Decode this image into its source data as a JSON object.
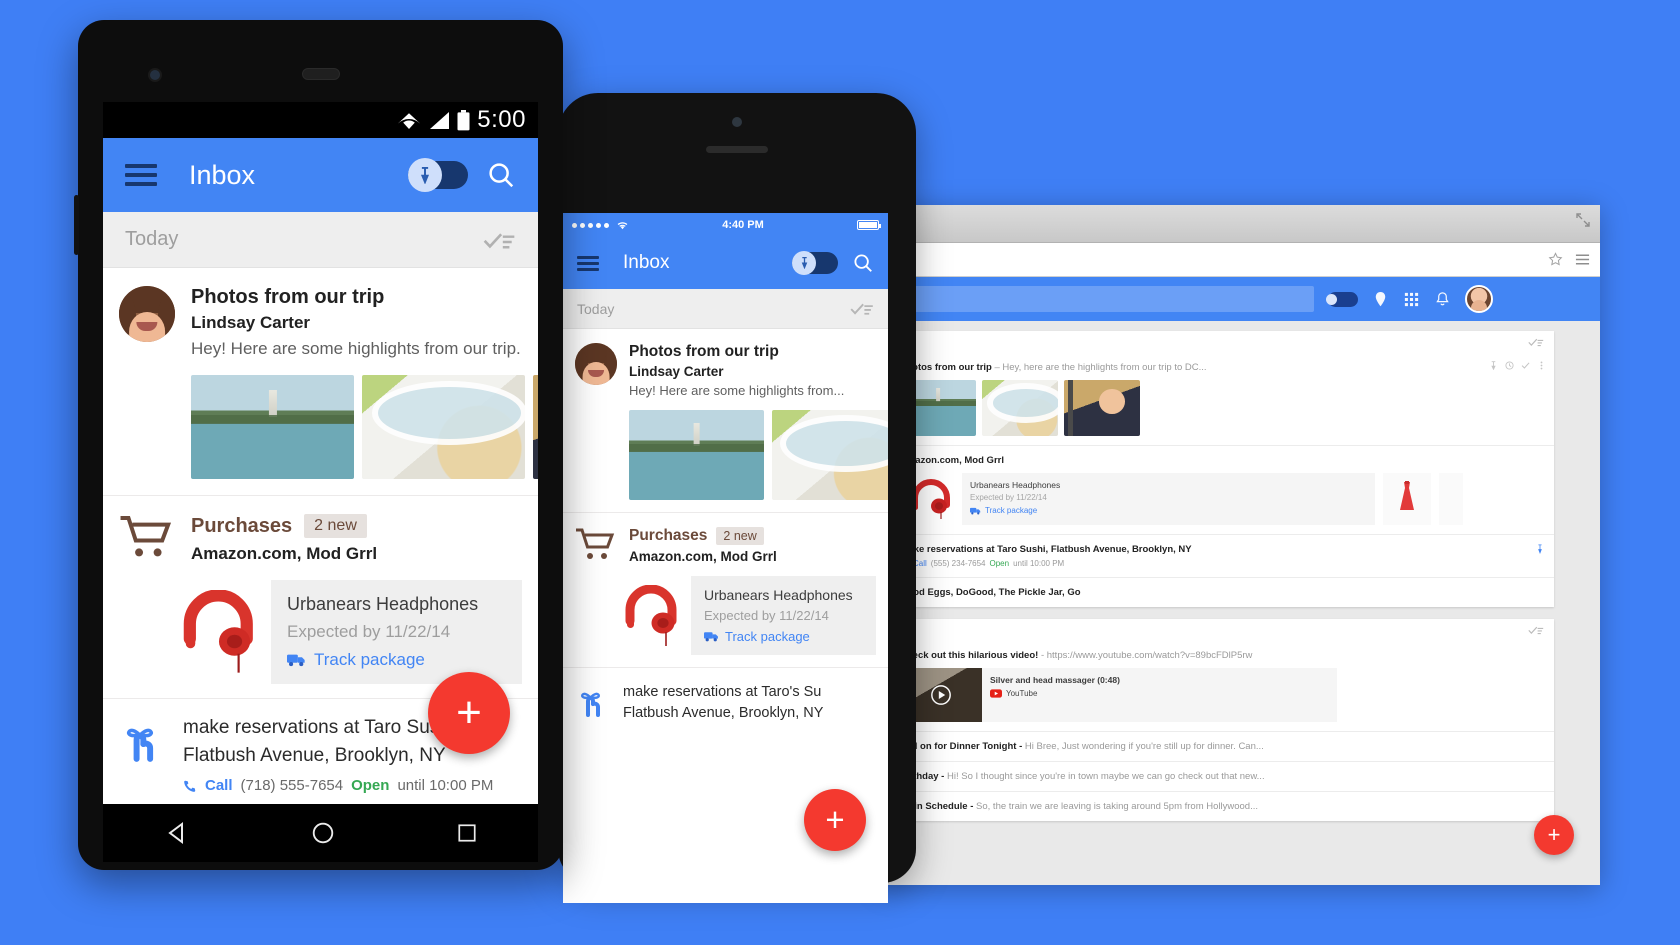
{
  "brand": {
    "accent_blue": "#4285f4",
    "bg_blue": "#3f7ff5",
    "fab_red": "#f4392f",
    "purchase_brown": "#6b4a3a",
    "open_green": "#35a853",
    "link_blue": "#4285f4"
  },
  "android": {
    "status": {
      "time": "5:00",
      "wifi_icon": "wifi-icon",
      "signal_icon": "signal-icon",
      "battery_icon": "battery-icon"
    },
    "appbar": {
      "menu_icon": "hamburger-menu-icon",
      "title": "Inbox",
      "pin_toggle_icon": "pin-toggle",
      "search_icon": "search-icon"
    },
    "today_bar": {
      "label": "Today",
      "sweep_icon": "sweep-done-icon"
    },
    "photos_bundle": {
      "avatar": "avatar-lindsay-carter",
      "subject": "Photos from our trip",
      "sender": "Lindsay Carter",
      "snippet": "Hey! Here are some highlights from our trip...",
      "thumbs": [
        "photo-washington-monument",
        "photo-food-plate",
        "photo-person"
      ]
    },
    "purchases_bundle": {
      "icon": "shopping-cart-icon",
      "title": "Purchases",
      "badge": "2 new",
      "senders": "Amazon.com, Mod Grrl",
      "card": {
        "image": "red-headphones-icon",
        "title": "Urbanears Headphones",
        "subtitle": "Expected by 11/22/14",
        "link_icon": "truck-icon",
        "link": "Track package"
      }
    },
    "reservation": {
      "icon": "reminder-finger-icon",
      "line1": "make reservations at Taro Sushi,",
      "line2": "Flatbush Avenue, Brooklyn, NY",
      "call_icon": "phone-icon",
      "call_label": "Call",
      "phone": "(718) 555-7654",
      "open_label": "Open",
      "until": "until 10:00 PM"
    },
    "fab": "+",
    "nav": {
      "back_icon": "back-triangle-icon",
      "home_icon": "home-circle-icon",
      "recents_icon": "recents-square-icon"
    }
  },
  "iphone": {
    "status": {
      "signal_icon": "signal-dots-icon",
      "wifi_icon": "wifi-icon",
      "time": "4:40 PM",
      "battery_icon": "battery-icon"
    },
    "appbar": {
      "menu_icon": "hamburger-menu-icon",
      "title": "Inbox",
      "pin_toggle_icon": "pin-toggle",
      "search_icon": "search-icon"
    },
    "today_bar": {
      "label": "Today",
      "sweep_icon": "sweep-done-icon"
    },
    "photos_bundle": {
      "avatar": "avatar-lindsay-carter",
      "subject": "Photos from our trip",
      "sender": "Lindsay Carter",
      "snippet": "Hey! Here are some highlights from...",
      "thumbs": [
        "photo-washington-monument",
        "photo-food-plate"
      ]
    },
    "purchases_bundle": {
      "icon": "shopping-cart-icon",
      "title": "Purchases",
      "badge": "2 new",
      "senders": "Amazon.com, Mod Grrl",
      "card": {
        "image": "red-headphones-icon",
        "title": "Urbanears Headphones",
        "subtitle": "Expected by 11/22/14",
        "link_icon": "truck-icon",
        "link": "Track package"
      }
    },
    "reservation": {
      "icon": "reminder-finger-icon",
      "line1": "make reservations at Taro's Su",
      "line2": "Flatbush Avenue, Brooklyn, NY"
    },
    "fab": "+"
  },
  "browser": {
    "chrome": {
      "expand_icon": "expand-icon",
      "star_icon": "star-icon",
      "menu_icon": "browser-menu-icon"
    },
    "omnibox": {
      "value": "",
      "placeholder": ""
    },
    "appbar": {
      "search_value": "",
      "pin_toggle_icon": "pin-toggle",
      "icons": [
        "reminder-icon",
        "apps-grid-icon",
        "notifications-bell-icon"
      ],
      "avatar": "avatar-user"
    },
    "clusters": [
      {
        "sweep_icon": "sweep-done-icon",
        "rows": [
          {
            "kind": "photos",
            "subject": "Photos from our trip",
            "snippet": "– Hey, here are the highlights from our trip to DC...",
            "row_icons": [
              "pin-icon",
              "snooze-icon",
              "done-icon",
              "more-icon"
            ],
            "thumbs": [
              "photo-washington-monument",
              "photo-food-plate",
              "photo-person"
            ]
          },
          {
            "kind": "purchases",
            "subject": "Amazon.com, Mod Grrl",
            "snippet": "",
            "card": {
              "image": "red-headphones-icon",
              "title": "Urbanears Headphones",
              "subtitle": "Expected by 11/22/14",
              "link_icon": "truck-icon",
              "link": "Track package"
            },
            "side_thumbs": [
              "dress-thumb",
              "next-thumb"
            ]
          },
          {
            "kind": "reservation",
            "subject": "make reservations at Taro Sushi, Flatbush Avenue, Brooklyn, NY",
            "call_icon": "phone-icon",
            "call_label": "Call",
            "phone": "(555) 234-7654",
            "open_label": "Open",
            "until": "until 10:00 PM",
            "pin_icon": "pin-icon"
          },
          {
            "kind": "plain",
            "subject": "Good Eggs, DoGood, The Pickle Jar, Go",
            "snippet": ""
          }
        ]
      },
      {
        "sweep_icon": "sweep-done-icon",
        "rows": [
          {
            "kind": "video",
            "subject": "Check out this hilarious video!",
            "snippet": "- https://www.youtube.com/watch?v=89bcFDlP5rw",
            "card": {
              "image": "video-thumb",
              "play_icon": "play-icon",
              "title": "Silver and head massager (0:48)",
              "source_icon": "youtube-icon",
              "source": "YouTube"
            }
          },
          {
            "kind": "plain",
            "subject": "Still on for Dinner Tonight -",
            "snippet": "Hi Bree, Just wondering if you're still up for dinner. Can..."
          },
          {
            "kind": "plain",
            "subject": "Birthday -",
            "snippet": "Hi! So I thought since you're in town maybe we can go check out that new..."
          },
          {
            "kind": "plain",
            "subject": "Train Schedule -",
            "snippet": "So, the train we are leaving is taking around 5pm from Hollywood..."
          }
        ]
      }
    ],
    "fab": "+"
  }
}
